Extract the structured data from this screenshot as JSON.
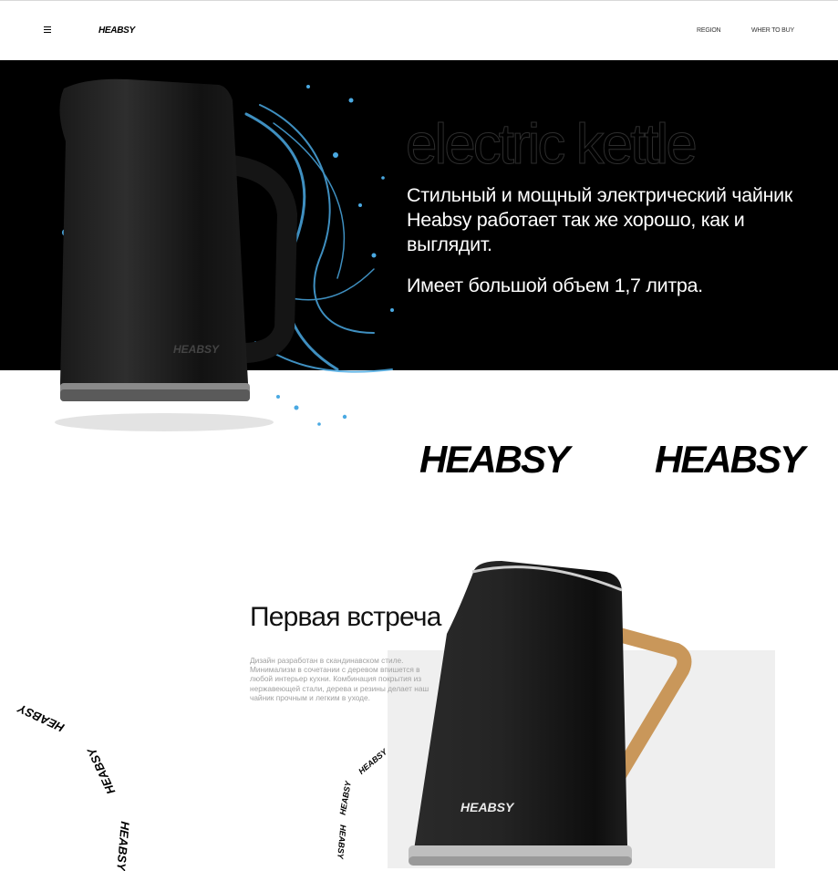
{
  "header": {
    "logo": "HEABSY",
    "nav": {
      "region": "REGION",
      "where_to_buy": "WHER TO BUY"
    }
  },
  "hero": {
    "title": "electric kettle",
    "description": "Стильный и мощный электрический чайник Heabsy работает так же хорошо, как и выглядит.",
    "volume": "Имеет большой объем 1,7 литра.",
    "kettle_brand": "HEABSY"
  },
  "brand_logos": [
    "HEABSY",
    "HEABSY"
  ],
  "section": {
    "title": "Первая встреча",
    "text": "Дизайн разработан в скандинавском стиле. Минимализм в сочетании с деревом впишется в любой интерьер кухни. Комбинация покрытия из нержавеющей стали, дерева и резины делает наш чайник прочным и легким в уходе.",
    "kettle_brand": "HEABSY"
  },
  "scatter_logos": [
    "HEABSY",
    "HEABSY",
    "HEABSY",
    "HEABSY",
    "HEABSY",
    "HEABSY"
  ],
  "colors": {
    "hero_bg": "#000000",
    "panel": "#efefef",
    "wood": "#c9975a",
    "water": "#3ea7e0"
  },
  "icons": [
    "menu-icon"
  ]
}
